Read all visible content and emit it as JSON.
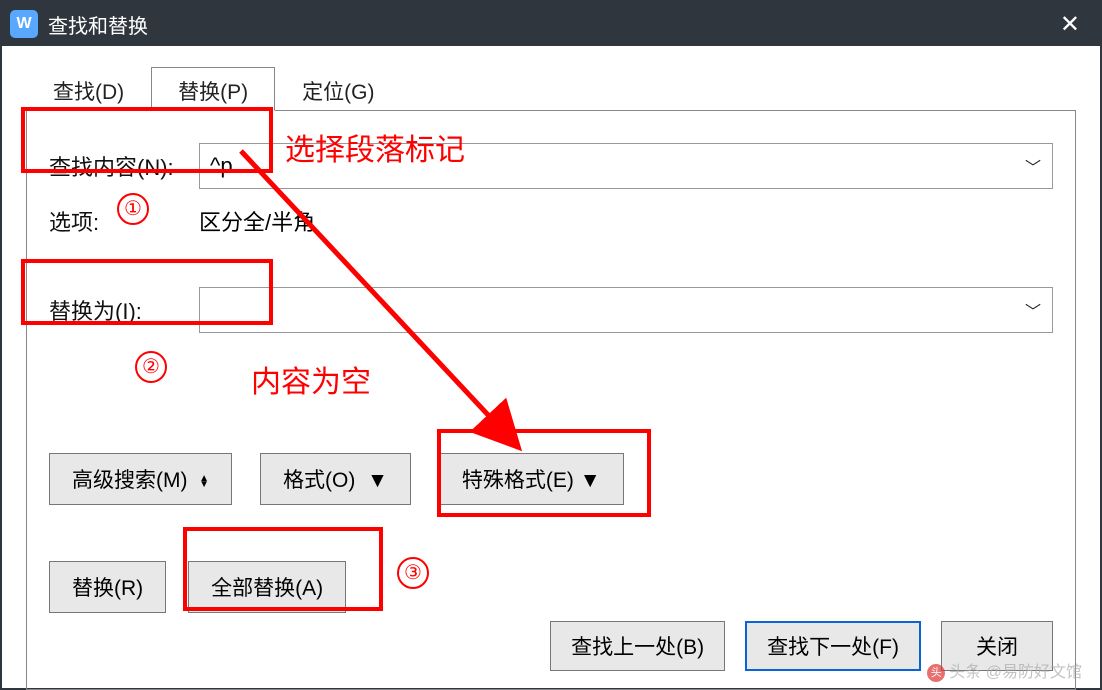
{
  "titlebar": {
    "app_icon_text": "W",
    "title": "查找和替换"
  },
  "tabs": {
    "find": "查找(D)",
    "replace": "替换(P)",
    "goto": "定位(G)"
  },
  "form": {
    "find_label": "查找内容(N):",
    "find_value": "^p",
    "options_label": "选项:",
    "options_value": "区分全/半角",
    "replace_label": "替换为(I):",
    "replace_value": ""
  },
  "buttons": {
    "advanced": "高级搜索(M)",
    "format": "格式(O)",
    "special": "特殊格式(E)",
    "replace_one": "替换(R)",
    "replace_all": "全部替换(A)",
    "find_prev": "查找上一处(B)",
    "find_next": "查找下一处(F)",
    "close": "关闭"
  },
  "annotations": {
    "note1": "选择段落标记",
    "note2": "内容为空",
    "mark1": "①",
    "mark2": "②",
    "mark3": "③"
  },
  "watermark": "头条 @易防好文馆"
}
